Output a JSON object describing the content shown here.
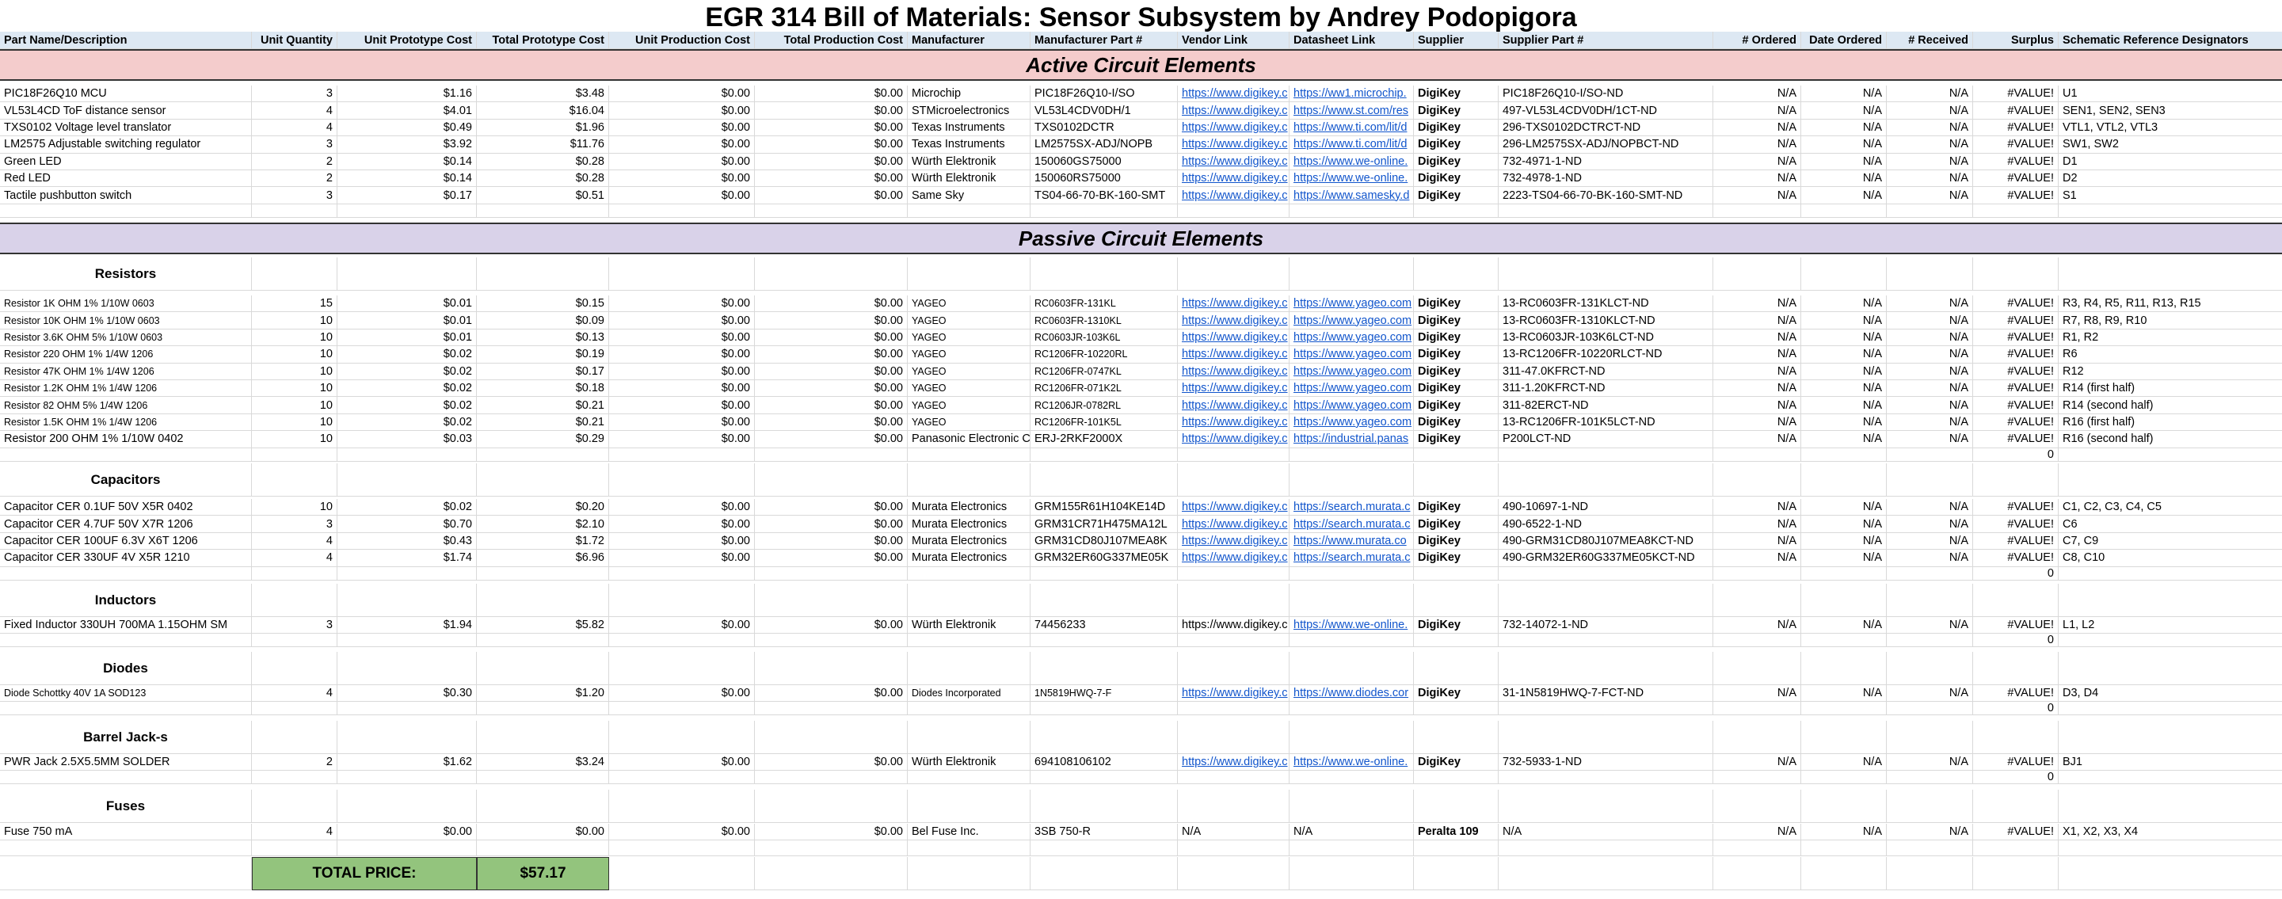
{
  "title": "EGR 314 Bill of Materials: Sensor Subsystem by Andrey Podopigora",
  "headers": [
    "Part Name/Description",
    "Unit Quantity",
    "Unit Prototype Cost",
    "Total Prototype Cost",
    "Unit Production Cost",
    "Total Production Cost",
    "Manufacturer",
    "Manufacturer Part #",
    "Vendor Link",
    "Datasheet Link",
    "Supplier",
    "Supplier Part #",
    "# Ordered",
    "Date Ordered",
    "# Received",
    "Surplus",
    "Schematic Reference Designators"
  ],
  "sections": {
    "active": "Active Circuit Elements",
    "passive": "Passive Circuit Elements"
  },
  "active_parts": [
    {
      "name": "PIC18F26Q10 MCU",
      "qty": "3",
      "unit": "$1.16",
      "total": "$3.48",
      "uprod": "$0.00",
      "tprod": "$0.00",
      "mfr": "Microchip",
      "mpn": "PIC18F26Q10-I/SO",
      "vendor": "https://www.digikey.c",
      "sheet": "https://ww1.microchip.",
      "supplier": "DigiKey",
      "spn": "PIC18F26Q10-I/SO-ND",
      "ordered": "N/A",
      "date": "N/A",
      "received": "N/A",
      "surplus": "#VALUE!",
      "refs": "U1"
    },
    {
      "name": "VL53L4CD ToF distance sensor",
      "qty": "4",
      "unit": "$4.01",
      "total": "$16.04",
      "uprod": "$0.00",
      "tprod": "$0.00",
      "mfr": "STMicroelectronics",
      "mpn": "VL53L4CDV0DH/1",
      "vendor": "https://www.digikey.c",
      "sheet": "https://www.st.com/res",
      "supplier": "DigiKey",
      "spn": "497-VL53L4CDV0DH/1CT-ND",
      "ordered": "N/A",
      "date": "N/A",
      "received": "N/A",
      "surplus": "#VALUE!",
      "refs": "SEN1, SEN2, SEN3"
    },
    {
      "name": "TXS0102 Voltage level translator",
      "qty": "4",
      "unit": "$0.49",
      "total": "$1.96",
      "uprod": "$0.00",
      "tprod": "$0.00",
      "mfr": "Texas Instruments",
      "mpn": "TXS0102DCTR",
      "vendor": "https://www.digikey.c",
      "sheet": "https://www.ti.com/lit/d",
      "supplier": "DigiKey",
      "spn": "296-TXS0102DCTRCT-ND",
      "ordered": "N/A",
      "date": "N/A",
      "received": "N/A",
      "surplus": "#VALUE!",
      "refs": "VTL1, VTL2, VTL3"
    },
    {
      "name": "LM2575 Adjustable switching regulator",
      "qty": "3",
      "unit": "$3.92",
      "total": "$11.76",
      "uprod": "$0.00",
      "tprod": "$0.00",
      "mfr": "Texas Instruments",
      "mpn": "LM2575SX-ADJ/NOPB",
      "vendor": "https://www.digikey.c",
      "sheet": "https://www.ti.com/lit/d",
      "supplier": "DigiKey",
      "spn": "296-LM2575SX-ADJ/NOPBCT-ND",
      "ordered": "N/A",
      "date": "N/A",
      "received": "N/A",
      "surplus": "#VALUE!",
      "refs": "SW1, SW2"
    },
    {
      "name": "Green LED",
      "qty": "2",
      "unit": "$0.14",
      "total": "$0.28",
      "uprod": "$0.00",
      "tprod": "$0.00",
      "mfr": "Würth Elektronik",
      "mpn": "150060GS75000",
      "vendor": "https://www.digikey.c",
      "sheet": "https://www.we-online.",
      "supplier": "DigiKey",
      "spn": "732-4971-1-ND",
      "ordered": "N/A",
      "date": "N/A",
      "received": "N/A",
      "surplus": "#VALUE!",
      "refs": "D1"
    },
    {
      "name": "Red LED",
      "qty": "2",
      "unit": "$0.14",
      "total": "$0.28",
      "uprod": "$0.00",
      "tprod": "$0.00",
      "mfr": "Würth Elektronik",
      "mpn": "150060RS75000",
      "vendor": "https://www.digikey.c",
      "sheet": "https://www.we-online.",
      "supplier": "DigiKey",
      "spn": "732-4978-1-ND",
      "ordered": "N/A",
      "date": "N/A",
      "received": "N/A",
      "surplus": "#VALUE!",
      "refs": "D2"
    },
    {
      "name": "Tactile pushbutton switch",
      "qty": "3",
      "unit": "$0.17",
      "total": "$0.51",
      "uprod": "$0.00",
      "tprod": "$0.00",
      "mfr": "Same Sky",
      "mpn": "TS04-66-70-BK-160-SMT",
      "vendor": "https://www.digikey.c",
      "sheet": "https://www.samesky.d",
      "supplier": "DigiKey",
      "spn": "2223-TS04-66-70-BK-160-SMT-ND",
      "ordered": "N/A",
      "date": "N/A",
      "received": "N/A",
      "surplus": "#VALUE!",
      "refs": "S1"
    }
  ],
  "categories": {
    "resistors": "Resistors",
    "capacitors": "Capacitors",
    "inductors": "Inductors",
    "diodes": "Diodes",
    "barrel": "Barrel Jack-s",
    "fuses": "Fuses"
  },
  "resistors": [
    {
      "name": "Resistor 1K OHM 1% 1/10W 0603",
      "qty": "15",
      "unit": "$0.01",
      "total": "$0.15",
      "uprod": "$0.00",
      "tprod": "$0.00",
      "mfr": "YAGEO",
      "mpn": "RC0603FR-131KL",
      "vendor": "https://www.digikey.c",
      "sheet": "https://www.yageo.com",
      "supplier": "DigiKey",
      "spn": "13-RC0603FR-131KLCT-ND",
      "ordered": "N/A",
      "date": "N/A",
      "received": "N/A",
      "surplus": "#VALUE!",
      "refs": "R3, R4, R5, R11, R13, R15"
    },
    {
      "name": "Resistor 10K OHM 1% 1/10W 0603",
      "qty": "10",
      "unit": "$0.01",
      "total": "$0.09",
      "uprod": "$0.00",
      "tprod": "$0.00",
      "mfr": "YAGEO",
      "mpn": "RC0603FR-1310KL",
      "vendor": "https://www.digikey.c",
      "sheet": "https://www.yageo.com",
      "supplier": "DigiKey",
      "spn": "13-RC0603FR-1310KLCT-ND",
      "ordered": "N/A",
      "date": "N/A",
      "received": "N/A",
      "surplus": "#VALUE!",
      "refs": "R7, R8, R9, R10"
    },
    {
      "name": "Resistor 3.6K OHM 5% 1/10W 0603",
      "qty": "10",
      "unit": "$0.01",
      "total": "$0.13",
      "uprod": "$0.00",
      "tprod": "$0.00",
      "mfr": "YAGEO",
      "mpn": "RC0603JR-103K6L",
      "vendor": "https://www.digikey.c",
      "sheet": "https://www.yageo.com",
      "supplier": "DigiKey",
      "spn": "13-RC0603JR-103K6LCT-ND",
      "ordered": "N/A",
      "date": "N/A",
      "received": "N/A",
      "surplus": "#VALUE!",
      "refs": "R1, R2"
    },
    {
      "name": "Resistor 220 OHM 1% 1/4W 1206",
      "qty": "10",
      "unit": "$0.02",
      "total": "$0.19",
      "uprod": "$0.00",
      "tprod": "$0.00",
      "mfr": "YAGEO",
      "mpn": "RC1206FR-10220RL",
      "vendor": "https://www.digikey.c",
      "sheet": "https://www.yageo.com",
      "supplier": "DigiKey",
      "spn": "13-RC1206FR-10220RLCT-ND",
      "ordered": "N/A",
      "date": "N/A",
      "received": "N/A",
      "surplus": "#VALUE!",
      "refs": "R6"
    },
    {
      "name": "Resistor 47K OHM 1% 1/4W 1206",
      "qty": "10",
      "unit": "$0.02",
      "total": "$0.17",
      "uprod": "$0.00",
      "tprod": "$0.00",
      "mfr": "YAGEO",
      "mpn": "RC1206FR-0747KL",
      "vendor": "https://www.digikey.c",
      "sheet": "https://www.yageo.com",
      "supplier": "DigiKey",
      "spn": "311-47.0KFRCT-ND",
      "ordered": "N/A",
      "date": "N/A",
      "received": "N/A",
      "surplus": "#VALUE!",
      "refs": "R12"
    },
    {
      "name": "Resistor 1.2K OHM 1% 1/4W 1206",
      "qty": "10",
      "unit": "$0.02",
      "total": "$0.18",
      "uprod": "$0.00",
      "tprod": "$0.00",
      "mfr": "YAGEO",
      "mpn": "RC1206FR-071K2L",
      "vendor": "https://www.digikey.c",
      "sheet": "https://www.yageo.com",
      "supplier": "DigiKey",
      "spn": "311-1.20KFRCT-ND",
      "ordered": "N/A",
      "date": "N/A",
      "received": "N/A",
      "surplus": "#VALUE!",
      "refs": "R14 (first half)"
    },
    {
      "name": "Resistor 82 OHM 5% 1/4W 1206",
      "qty": "10",
      "unit": "$0.02",
      "total": "$0.21",
      "uprod": "$0.00",
      "tprod": "$0.00",
      "mfr": "YAGEO",
      "mpn": "RC1206JR-0782RL",
      "vendor": "https://www.digikey.c",
      "sheet": "https://www.yageo.com",
      "supplier": "DigiKey",
      "spn": "311-82ERCT-ND",
      "ordered": "N/A",
      "date": "N/A",
      "received": "N/A",
      "surplus": "#VALUE!",
      "refs": "R14 (second half)"
    },
    {
      "name": "Resistor 1.5K OHM 1% 1/4W 1206",
      "qty": "10",
      "unit": "$0.02",
      "total": "$0.21",
      "uprod": "$0.00",
      "tprod": "$0.00",
      "mfr": "YAGEO",
      "mpn": "RC1206FR-101K5L",
      "vendor": "https://www.digikey.c",
      "sheet": "https://www.yageo.com",
      "supplier": "DigiKey",
      "spn": "13-RC1206FR-101K5LCT-ND",
      "ordered": "N/A",
      "date": "N/A",
      "received": "N/A",
      "surplus": "#VALUE!",
      "refs": "R16 (first half)"
    },
    {
      "name": "Resistor 200 OHM 1% 1/10W 0402",
      "qty": "10",
      "unit": "$0.03",
      "total": "$0.29",
      "uprod": "$0.00",
      "tprod": "$0.00",
      "mfr": "Panasonic Electronic C",
      "mpn": "ERJ-2RKF2000X",
      "vendor": "https://www.digikey.c",
      "sheet": "https://industrial.panas",
      "supplier": "DigiKey",
      "spn": "P200LCT-ND",
      "ordered": "N/A",
      "date": "N/A",
      "received": "N/A",
      "surplus": "#VALUE!",
      "refs": "R16 (second half)"
    }
  ],
  "capacitors": [
    {
      "name": "Capacitor CER 0.1UF 50V X5R 0402",
      "qty": "10",
      "unit": "$0.02",
      "total": "$0.20",
      "uprod": "$0.00",
      "tprod": "$0.00",
      "mfr": "Murata Electronics",
      "mpn": "GRM155R61H104KE14D",
      "vendor": "https://www.digikey.c",
      "sheet": "https://search.murata.c",
      "supplier": "DigiKey",
      "spn": "490-10697-1-ND",
      "ordered": "N/A",
      "date": "N/A",
      "received": "N/A",
      "surplus": "#VALUE!",
      "refs": "C1, C2, C3, C4, C5"
    },
    {
      "name": "Capacitor CER 4.7UF 50V X7R 1206",
      "qty": "3",
      "unit": "$0.70",
      "total": "$2.10",
      "uprod": "$0.00",
      "tprod": "$0.00",
      "mfr": "Murata Electronics",
      "mpn": "GRM31CR71H475MA12L",
      "vendor": "https://www.digikey.c",
      "sheet": "https://search.murata.c",
      "supplier": "DigiKey",
      "spn": "490-6522-1-ND",
      "ordered": "N/A",
      "date": "N/A",
      "received": "N/A",
      "surplus": "#VALUE!",
      "refs": "C6"
    },
    {
      "name": "Capacitor CER 100UF 6.3V X6T 1206",
      "qty": "4",
      "unit": "$0.43",
      "total": "$1.72",
      "uprod": "$0.00",
      "tprod": "$0.00",
      "mfr": "Murata Electronics",
      "mpn": "GRM31CD80J107MEA8K",
      "vendor": "https://www.digikey.c",
      "sheet": "https://www.murata.co",
      "supplier": "DigiKey",
      "spn": "490-GRM31CD80J107MEA8KCT-ND",
      "ordered": "N/A",
      "date": "N/A",
      "received": "N/A",
      "surplus": "#VALUE!",
      "refs": "C7, C9"
    },
    {
      "name": "Capacitor CER 330UF 4V X5R 1210",
      "qty": "4",
      "unit": "$1.74",
      "total": "$6.96",
      "uprod": "$0.00",
      "tprod": "$0.00",
      "mfr": "Murata Electronics",
      "mpn": "GRM32ER60G337ME05K",
      "vendor": "https://www.digikey.c",
      "sheet": "https://search.murata.c",
      "supplier": "DigiKey",
      "spn": "490-GRM32ER60G337ME05KCT-ND",
      "ordered": "N/A",
      "date": "N/A",
      "received": "N/A",
      "surplus": "#VALUE!",
      "refs": "C8, C10"
    }
  ],
  "inductors": [
    {
      "name": "Fixed Inductor 330UH 700MA 1.15OHM SM",
      "qty": "3",
      "unit": "$1.94",
      "total": "$5.82",
      "uprod": "$0.00",
      "tprod": "$0.00",
      "mfr": "Würth Elektronik",
      "mpn": "74456233",
      "vendor": "https://www.digikey.c",
      "sheet": "https://www.we-online.",
      "supplier": "DigiKey",
      "spn": "732-14072-1-ND",
      "ordered": "N/A",
      "date": "N/A",
      "received": "N/A",
      "surplus": "#VALUE!",
      "refs": "L1, L2"
    }
  ],
  "diodes": [
    {
      "name": "Diode Schottky 40V 1A SOD123",
      "qty": "4",
      "unit": "$0.30",
      "total": "$1.20",
      "uprod": "$0.00",
      "tprod": "$0.00",
      "mfr": "Diodes Incorporated",
      "mpn": "1N5819HWQ-7-F",
      "vendor": "https://www.digikey.c",
      "sheet": "https://www.diodes.cor",
      "supplier": "DigiKey",
      "spn": "31-1N5819HWQ-7-FCT-ND",
      "ordered": "N/A",
      "date": "N/A",
      "received": "N/A",
      "surplus": "#VALUE!",
      "refs": "D3, D4"
    }
  ],
  "barrel": [
    {
      "name": "PWR Jack 2.5X5.5MM SOLDER",
      "qty": "2",
      "unit": "$1.62",
      "total": "$3.24",
      "uprod": "$0.00",
      "tprod": "$0.00",
      "mfr": "Würth Elektronik",
      "mpn": "694108106102",
      "vendor": "https://www.digikey.c",
      "sheet": "https://www.we-online.",
      "supplier": "DigiKey",
      "spn": "732-5933-1-ND",
      "ordered": "N/A",
      "date": "N/A",
      "received": "N/A",
      "surplus": "#VALUE!",
      "refs": "BJ1"
    }
  ],
  "fuses": [
    {
      "name": "Fuse 750 mA",
      "qty": "4",
      "unit": "$0.00",
      "total": "$0.00",
      "uprod": "$0.00",
      "tprod": "$0.00",
      "mfr": "Bel Fuse Inc.",
      "mpn": "3SB 750-R",
      "vendor": "N/A",
      "sheet": "N/A",
      "supplier": "Peralta 109",
      "spn": "N/A",
      "ordered": "N/A",
      "date": "N/A",
      "received": "N/A",
      "surplus": "#VALUE!",
      "refs": "X1, X2, X3, X4"
    }
  ],
  "zero": "0",
  "total": {
    "label": "TOTAL  PRICE:",
    "value": "$57.17"
  },
  "colors": {
    "header_bg": "#dde8f3",
    "active_bg": "#f4cccc",
    "passive_bg": "#d9d2e9",
    "total_bg": "#93c47d",
    "link": "#1155cc"
  }
}
